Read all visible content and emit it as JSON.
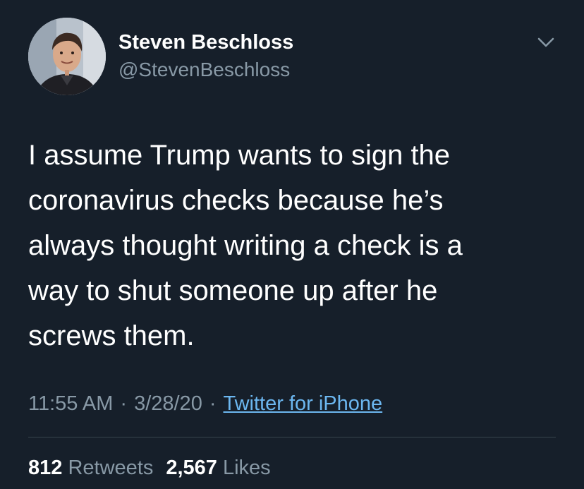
{
  "author": {
    "display_name": "Steven Beschloss",
    "handle": "@StevenBeschloss",
    "avatar_icon": "profile-photo"
  },
  "menu": {
    "icon": "chevron-down-icon"
  },
  "tweet": {
    "text_lines": [
      "I assume Trump wants to sign the",
      "coronavirus checks because he’s",
      "always thought writing a check is a",
      "way to shut someone up after he",
      "screws them."
    ],
    "time": "11:55 AM",
    "separator": "·",
    "date": "3/28/20",
    "source": "Twitter for iPhone"
  },
  "stats": {
    "retweets_count": "812",
    "retweets_label": "Retweets",
    "likes_count": "2,567",
    "likes_label": "Likes"
  },
  "colors": {
    "background": "#161f2a",
    "secondary_text": "#8899a6",
    "link": "#6cb7f0",
    "divider": "#38444d"
  }
}
